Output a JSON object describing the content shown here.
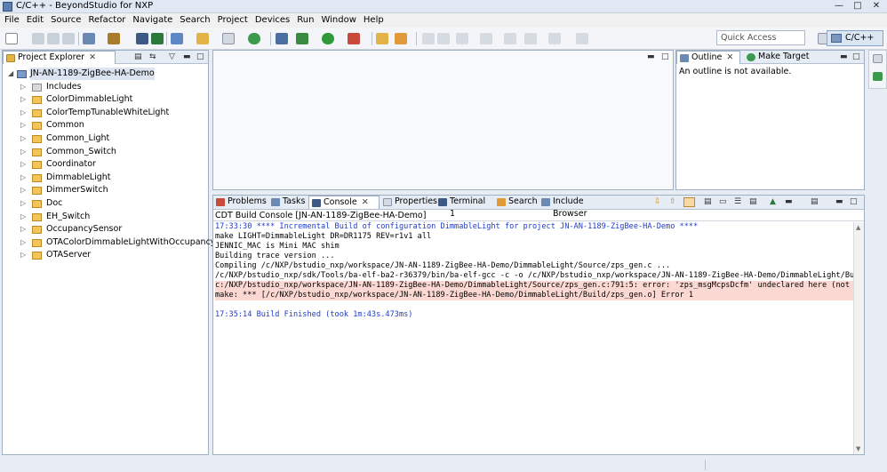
{
  "window": {
    "title": "C/C++ - BeyondStudio for NXP"
  },
  "menu": [
    "File",
    "Edit",
    "Source",
    "Refactor",
    "Navigate",
    "Search",
    "Project",
    "Devices",
    "Run",
    "Window",
    "Help"
  ],
  "toolbar": {
    "quick_access_placeholder": "Quick Access",
    "perspective_label": "C/C++"
  },
  "project_explorer": {
    "tab_label": "Project Explorer",
    "project": "JN-AN-1189-ZigBee-HA-Demo",
    "items": [
      "Includes",
      "ColorDimmableLight",
      "ColorTempTunableWhiteLight",
      "Common",
      "Common_Light",
      "Common_Switch",
      "Coordinator",
      "DimmableLight",
      "DimmerSwitch",
      "Doc",
      "EH_Switch",
      "OccupancySensor",
      "OTAColorDimmableLightWithOccupancy",
      "OTAServer"
    ]
  },
  "outline": {
    "tab_label": "Outline",
    "tab2_label": "Make Target",
    "message": "An outline is not available."
  },
  "bottom_tabs": [
    "Problems",
    "Tasks",
    "Console",
    "Properties",
    "Terminal 1",
    "Search",
    "Include Browser"
  ],
  "console": {
    "header": "CDT Build Console [JN-AN-1189-ZigBee-HA-Demo]",
    "lines": [
      {
        "text": "17:33:30 **** Incremental Build of configuration DimmableLight for project JN-AN-1189-ZigBee-HA-Demo ****",
        "style": "blue"
      },
      {
        "text": "make LIGHT=DimmableLight DR=DR1175 REV=r1v1 all",
        "style": "normal"
      },
      {
        "text": "JENNIC_MAC is Mini MAC shim",
        "style": "normal"
      },
      {
        "text": "Building trace version ...",
        "style": "normal"
      },
      {
        "text": "Compiling /c/NXP/bstudio_nxp/workspace/JN-AN-1189-ZigBee-HA-Demo/DimmableLight/Source/zps_gen.c ...",
        "style": "normal"
      },
      {
        "text": "/c/NXP/bstudio_nxp/sdk/Tools/ba-elf-ba2-r36379/bin/ba-elf-gcc -c -o /c/NXP/bstudio_nxp/workspace/JN-AN-1189-ZigBee-HA-Demo/DimmableLight/Bui",
        "style": "normal"
      },
      {
        "text": "c:/NXP/bstudio_nxp/workspace/JN-AN-1189-ZigBee-HA-Demo/DimmableLight/Source/zps_gen.c:791:5: error: 'zps_msgMcpsDcfm' undeclared here (not i",
        "style": "err"
      },
      {
        "text": "make: *** [/c/NXP/bstudio_nxp/workspace/JN-AN-1189-ZigBee-HA-Demo/DimmableLight/Build/zps_gen.o] Error 1",
        "style": "err"
      },
      {
        "text": "",
        "style": "normal"
      },
      {
        "text": "17:35:14 Build Finished (took 1m:43s.473ms)",
        "style": "blue"
      }
    ]
  }
}
